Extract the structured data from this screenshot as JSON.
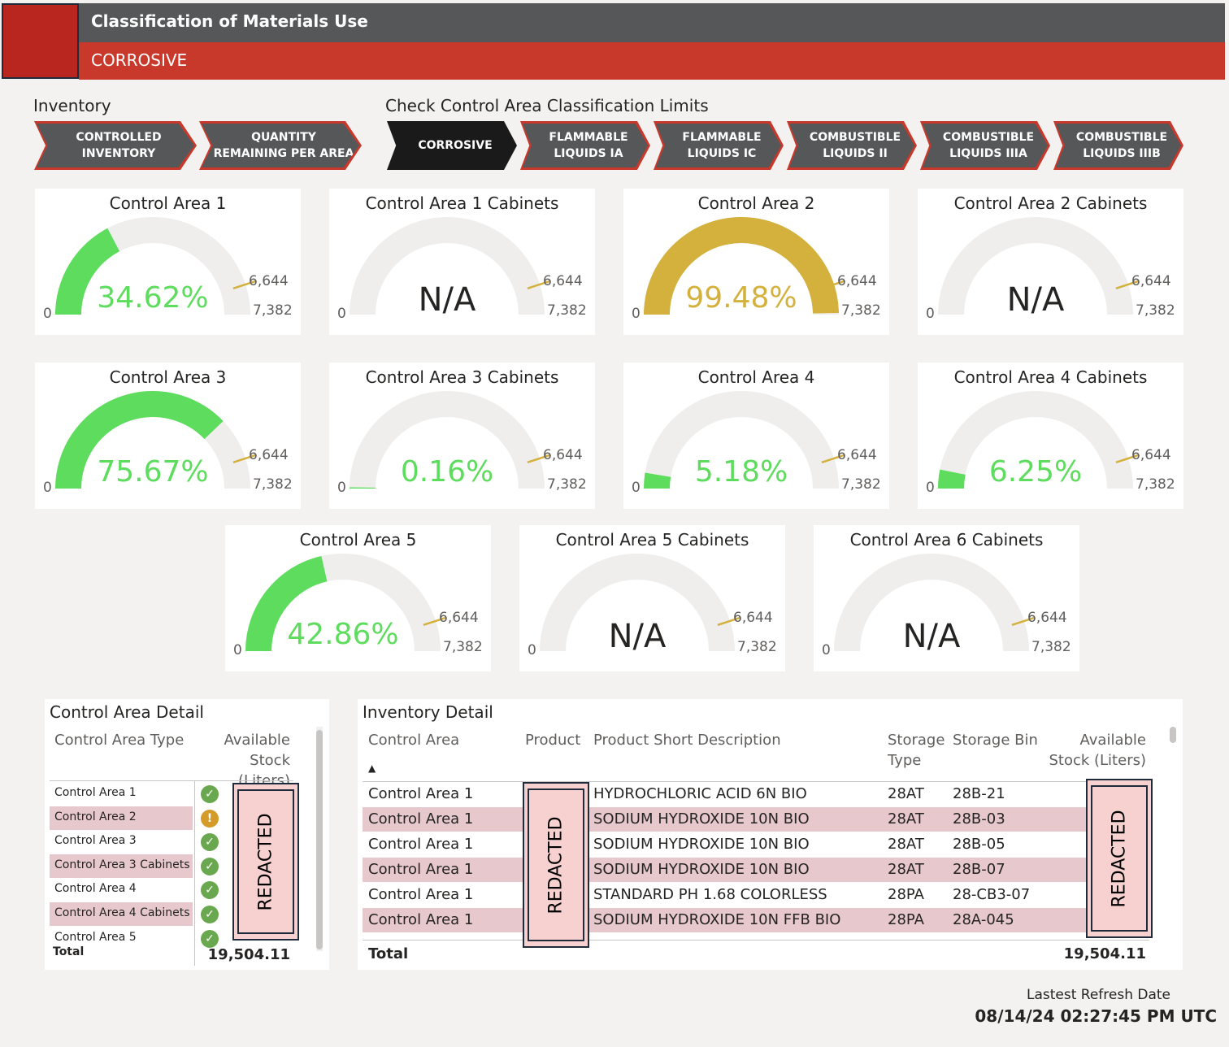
{
  "header": {
    "title": "Classification of Materials Use",
    "subtitle": "CORROSIVE"
  },
  "nav": {
    "inventory_label": "Inventory",
    "limits_label": "Check Control Area Classification Limits",
    "inventory_tabs": [
      {
        "line1": "CONTROLLED",
        "line2": "INVENTORY"
      },
      {
        "line1": "QUANTITY",
        "line2": "REMAINING PER AREA"
      }
    ],
    "limit_tabs": [
      {
        "line1": "CORROSIVE",
        "line2": ""
      },
      {
        "line1": "FLAMMABLE",
        "line2": "LIQUIDS IA"
      },
      {
        "line1": "FLAMMABLE",
        "line2": "LIQUIDS IC"
      },
      {
        "line1": "COMBUSTIBLE",
        "line2": "LIQUIDS II"
      },
      {
        "line1": "COMBUSTIBLE",
        "line2": "LIQUIDS IIIA"
      },
      {
        "line1": "COMBUSTIBLE",
        "line2": "LIQUIDS IIIB"
      }
    ],
    "active_tab": "CORROSIVE"
  },
  "gauges": [
    {
      "title": "Control Area 1",
      "value_text": "34.62%",
      "fraction": 0.3462,
      "color": "#5ddc5d",
      "min": "0",
      "target": "6,644",
      "max": "7,382"
    },
    {
      "title": "Control Area 1 Cabinets",
      "value_text": "N/A",
      "fraction": 0,
      "color": "#5ddc5d",
      "min": "0",
      "target": "6,644",
      "max": "7,382"
    },
    {
      "title": "Control Area 2",
      "value_text": "99.48%",
      "fraction": 0.9948,
      "color": "#d4b13c",
      "min": "0",
      "target": "6,644",
      "max": "7,382"
    },
    {
      "title": "Control Area 2 Cabinets",
      "value_text": "N/A",
      "fraction": 0,
      "color": "#5ddc5d",
      "min": "0",
      "target": "6,644",
      "max": "7,382"
    },
    {
      "title": "Control Area 3",
      "value_text": "75.67%",
      "fraction": 0.7567,
      "color": "#5ddc5d",
      "min": "0",
      "target": "6,644",
      "max": "7,382"
    },
    {
      "title": "Control Area 3 Cabinets",
      "value_text": "0.16%",
      "fraction": 0.0016,
      "color": "#5ddc5d",
      "min": "0",
      "target": "6,644",
      "max": "7,382"
    },
    {
      "title": "Control Area 4",
      "value_text": "5.18%",
      "fraction": 0.0518,
      "color": "#5ddc5d",
      "min": "0",
      "target": "6,644",
      "max": "7,382"
    },
    {
      "title": "Control Area 4 Cabinets",
      "value_text": "6.25%",
      "fraction": 0.0625,
      "color": "#5ddc5d",
      "min": "0",
      "target": "6,644",
      "max": "7,382"
    },
    {
      "title": "Control Area 5",
      "value_text": "42.86%",
      "fraction": 0.4286,
      "color": "#5ddc5d",
      "min": "0",
      "target": "6,644",
      "max": "7,382"
    },
    {
      "title": "Control Area 5 Cabinets",
      "value_text": "N/A",
      "fraction": 0,
      "color": "#5ddc5d",
      "min": "0",
      "target": "6,644",
      "max": "7,382"
    },
    {
      "title": "Control Area 6 Cabinets",
      "value_text": "N/A",
      "fraction": 0,
      "color": "#5ddc5d",
      "min": "0",
      "target": "6,644",
      "max": "7,382"
    }
  ],
  "gauge_colors": {
    "track": "#efeeed",
    "target": "#d4b13c",
    "na_text": "#252423"
  },
  "area_detail": {
    "title": "Control Area Detail",
    "col_type": "Control Area Type",
    "col_stock_1": "Available",
    "col_stock_2": "Stock (Liters)",
    "rows": [
      {
        "type": "Control Area 1",
        "status": "ok"
      },
      {
        "type": "Control Area 2",
        "status": "warn"
      },
      {
        "type": "Control Area 3",
        "status": "ok"
      },
      {
        "type": "Control Area 3 Cabinets",
        "status": "ok"
      },
      {
        "type": "Control Area 4",
        "status": "ok"
      },
      {
        "type": "Control Area 4 Cabinets",
        "status": "ok"
      },
      {
        "type": "Control Area 5",
        "status": "ok"
      }
    ],
    "total_label": "Total",
    "total_value": "19,504.11",
    "redacted": "REDACTED"
  },
  "inventory_detail": {
    "title": "Inventory Detail",
    "cols": {
      "area": "Control Area",
      "product": "Product",
      "desc": "Product Short Description",
      "storage_type_1": "Storage",
      "storage_type_2": "Type",
      "bin": "Storage Bin",
      "stock_1": "Available",
      "stock_2": "Stock (Liters)"
    },
    "sort_indicator": "▲",
    "rows": [
      {
        "area": "Control Area 1",
        "desc": "HYDROCHLORIC ACID 6N BIO",
        "type": "28AT",
        "bin": "28B-21"
      },
      {
        "area": "Control Area 1",
        "desc": "SODIUM HYDROXIDE 10N BIO",
        "type": "28AT",
        "bin": "28B-03"
      },
      {
        "area": "Control Area 1",
        "desc": "SODIUM HYDROXIDE 10N BIO",
        "type": "28AT",
        "bin": "28B-05"
      },
      {
        "area": "Control Area 1",
        "desc": "SODIUM HYDROXIDE 10N BIO",
        "type": "28AT",
        "bin": "28B-07"
      },
      {
        "area": "Control Area 1",
        "desc": "STANDARD PH 1.68 COLORLESS",
        "type": "28PA",
        "bin": "28-CB3-07"
      },
      {
        "area": "Control Area 1",
        "desc": "SODIUM HYDROXIDE 10N FFB BIO",
        "type": "28PA",
        "bin": "28A-045"
      }
    ],
    "total_label": "Total",
    "total_value": "19,504.11",
    "redacted": "REDACTED"
  },
  "refresh": {
    "label": "Lastest Refresh Date",
    "value": "08/14/24 02:27:45 PM UTC"
  }
}
